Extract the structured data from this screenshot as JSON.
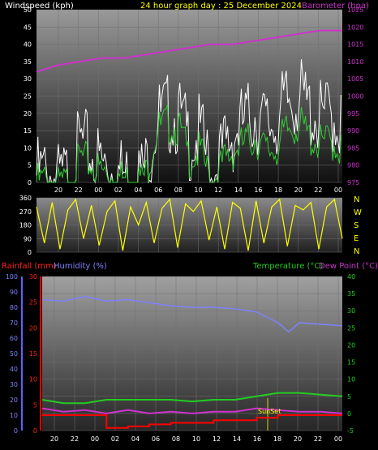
{
  "header": {
    "windspeed": "Windspeed (kph)",
    "title": "24 hour graph day : 25 December 2024",
    "barometer": "Barometer (hpa)"
  },
  "lower_header": {
    "rainfall": "Rainfall (mm)",
    "humidity": "Humidity (%)",
    "temperature": "Temperature (°C)",
    "dewpoint": "Dew Point (°C)"
  },
  "compass": [
    "N",
    "W",
    "S",
    "E",
    "N"
  ],
  "sunset_label": "SunSet",
  "colors": {
    "wind_gust": "#ffffff",
    "wind_avg": "#33cc33",
    "barometer": "#cc33cc",
    "direction": "#ffff00",
    "humidity": "#8080ff",
    "temperature": "#22cc22",
    "dewpoint": "#cc33cc",
    "rainfall": "#ff0000"
  },
  "chart_data": [
    {
      "type": "line",
      "name": "wind-barometer",
      "x_tick_labels": [
        "20",
        "22",
        "00",
        "02",
        "04",
        "06",
        "08",
        "10",
        "12",
        "14",
        "16",
        "18",
        "20",
        "22",
        "00"
      ],
      "left_axis": {
        "ylim": [
          0,
          50
        ],
        "ticks": [
          0,
          5,
          10,
          15,
          20,
          25,
          30,
          35,
          40,
          45,
          50
        ]
      },
      "right_axis": {
        "ylim": [
          975,
          1025
        ],
        "ticks": [
          975,
          980,
          985,
          990,
          995,
          1000,
          1005,
          1010,
          1015,
          1020,
          1025
        ]
      },
      "series": [
        {
          "name": "Windspeed (kph)",
          "axis": "left",
          "x": [
            0,
            1,
            2,
            3,
            4,
            5,
            6,
            7,
            8,
            9,
            10,
            11,
            12,
            13,
            14,
            15,
            16,
            17,
            18,
            19,
            20,
            21,
            22,
            23,
            24,
            25,
            26,
            27,
            28
          ],
          "values": [
            3,
            4,
            2,
            3,
            10,
            8,
            6,
            5,
            4,
            3,
            5,
            18,
            20,
            19,
            10,
            12,
            3,
            8,
            12,
            14,
            16,
            12,
            13,
            18,
            20,
            16,
            14,
            15,
            12
          ]
        },
        {
          "name": "Gust (kph)",
          "axis": "left",
          "x": [
            0,
            1,
            2,
            3,
            4,
            5,
            6,
            7,
            8,
            9,
            10,
            11,
            12,
            13,
            14,
            15,
            16,
            17,
            18,
            19,
            20,
            21,
            22,
            23,
            24,
            25,
            26,
            27,
            28
          ],
          "values": [
            8,
            9,
            6,
            8,
            17,
            14,
            11,
            10,
            8,
            7,
            10,
            24,
            26,
            25,
            18,
            20,
            8,
            14,
            20,
            23,
            26,
            22,
            24,
            29,
            31,
            27,
            24,
            26,
            22
          ]
        },
        {
          "name": "Barometer (hpa)",
          "axis": "right",
          "x": [
            0,
            2,
            4,
            6,
            8,
            10,
            12,
            14,
            16,
            18,
            20,
            22,
            24,
            26,
            28
          ],
          "values": [
            1007,
            1009,
            1010,
            1011,
            1011,
            1012,
            1013,
            1014,
            1015,
            1015,
            1016,
            1017,
            1018,
            1019,
            1019
          ]
        }
      ]
    },
    {
      "type": "scatter",
      "name": "wind-direction",
      "x_tick_labels": [
        "20",
        "22",
        "00",
        "02",
        "04",
        "06",
        "08",
        "10",
        "12",
        "14",
        "16",
        "18",
        "20",
        "22",
        "00"
      ],
      "ylim": [
        0,
        360
      ],
      "y_ticks": [
        0,
        90,
        180,
        270,
        360
      ],
      "description_levels": "direction in degrees",
      "values": [
        300,
        60,
        330,
        20,
        280,
        350,
        90,
        310,
        45,
        270,
        340,
        10,
        300,
        180,
        330,
        60,
        290,
        350,
        30,
        320,
        270,
        340,
        80,
        300,
        20,
        330,
        290,
        10,
        340,
        60,
        300,
        350,
        40,
        310,
        280,
        330,
        20,
        300,
        350,
        90
      ]
    },
    {
      "type": "line",
      "name": "temperature-humidity-rain",
      "x_tick_labels": [
        "20",
        "22",
        "00",
        "02",
        "04",
        "06",
        "08",
        "10",
        "12",
        "14",
        "16",
        "18",
        "20",
        "22",
        "00"
      ],
      "left_axis_humidity": {
        "ylim": [
          0,
          100
        ],
        "ticks": [
          0,
          10,
          20,
          30,
          40,
          50,
          60,
          70,
          80,
          90,
          100
        ]
      },
      "left_axis_rain": {
        "ylim": [
          0,
          30
        ],
        "ticks": [
          0,
          5,
          10,
          15,
          20,
          25,
          30
        ]
      },
      "right_axis": {
        "ylim": [
          -5,
          40
        ],
        "ticks": [
          -5,
          0,
          5,
          10,
          15,
          20,
          25,
          30,
          35,
          40
        ]
      },
      "series": [
        {
          "name": "Humidity (%)",
          "axis": "humidity",
          "x": [
            0,
            2,
            4,
            6,
            8,
            10,
            12,
            14,
            16,
            18,
            20,
            22,
            23,
            24,
            26,
            28
          ],
          "values": [
            85,
            84,
            87,
            84,
            85,
            83,
            81,
            80,
            80,
            79,
            77,
            70,
            64,
            70,
            69,
            68
          ]
        },
        {
          "name": "Temperature (°C)",
          "axis": "right",
          "x": [
            0,
            2,
            4,
            6,
            8,
            10,
            12,
            14,
            16,
            18,
            20,
            22,
            24,
            26,
            28
          ],
          "values": [
            4,
            3,
            3,
            4,
            4,
            4,
            4,
            3.5,
            4,
            4,
            5,
            6,
            6,
            5.5,
            5
          ]
        },
        {
          "name": "Dew Point (°C)",
          "axis": "right",
          "x": [
            0,
            2,
            4,
            6,
            8,
            10,
            12,
            14,
            16,
            18,
            20,
            22,
            24,
            26,
            28
          ],
          "values": [
            1.5,
            0.5,
            1,
            0,
            1,
            0,
            0.5,
            0,
            0.5,
            0.5,
            1.5,
            1,
            0.5,
            0.5,
            0
          ]
        },
        {
          "name": "Rainfall (mm)",
          "axis": "rain",
          "x": [
            0,
            2,
            4,
            6,
            8,
            10,
            12,
            14,
            16,
            18,
            20,
            22,
            24,
            26,
            28
          ],
          "values": [
            3,
            3,
            3,
            0.5,
            0.8,
            1.2,
            1.5,
            1.5,
            2,
            2,
            2.5,
            3,
            3,
            3,
            3
          ]
        }
      ]
    }
  ]
}
